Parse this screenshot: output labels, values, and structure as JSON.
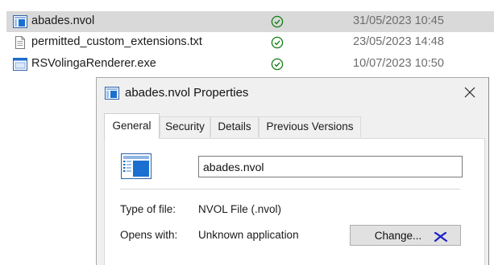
{
  "files": [
    {
      "name": "abades.nvol",
      "date": "31/05/2023 10:45",
      "selected": true,
      "icon": "nvol-file-icon",
      "status": "synced-check-icon"
    },
    {
      "name": "permitted_custom_extensions.txt",
      "date": "23/05/2023 14:48",
      "selected": false,
      "icon": "text-file-icon",
      "status": "synced-check-icon"
    },
    {
      "name": "RSVolingaRenderer.exe",
      "date": "10/07/2023 10:50",
      "selected": false,
      "icon": "exe-file-icon",
      "status": "synced-check-icon"
    }
  ],
  "dialog": {
    "title": "abades.nvol Properties",
    "close_icon": "close-icon",
    "tabs": [
      "General",
      "Security",
      "Details",
      "Previous Versions"
    ],
    "active_tab": "General",
    "filename_value": "abades.nvol",
    "type_label": "Type of file:",
    "type_value": "NVOL File (.nvol)",
    "opens_label": "Opens with:",
    "opens_value": "Unknown application",
    "change_label": "Change..."
  },
  "colors": {
    "selection": "#d9d9d9",
    "status_green": "#107c10",
    "icon_blue": "#1a6fd1",
    "cursor_blue": "#1e22c8"
  }
}
